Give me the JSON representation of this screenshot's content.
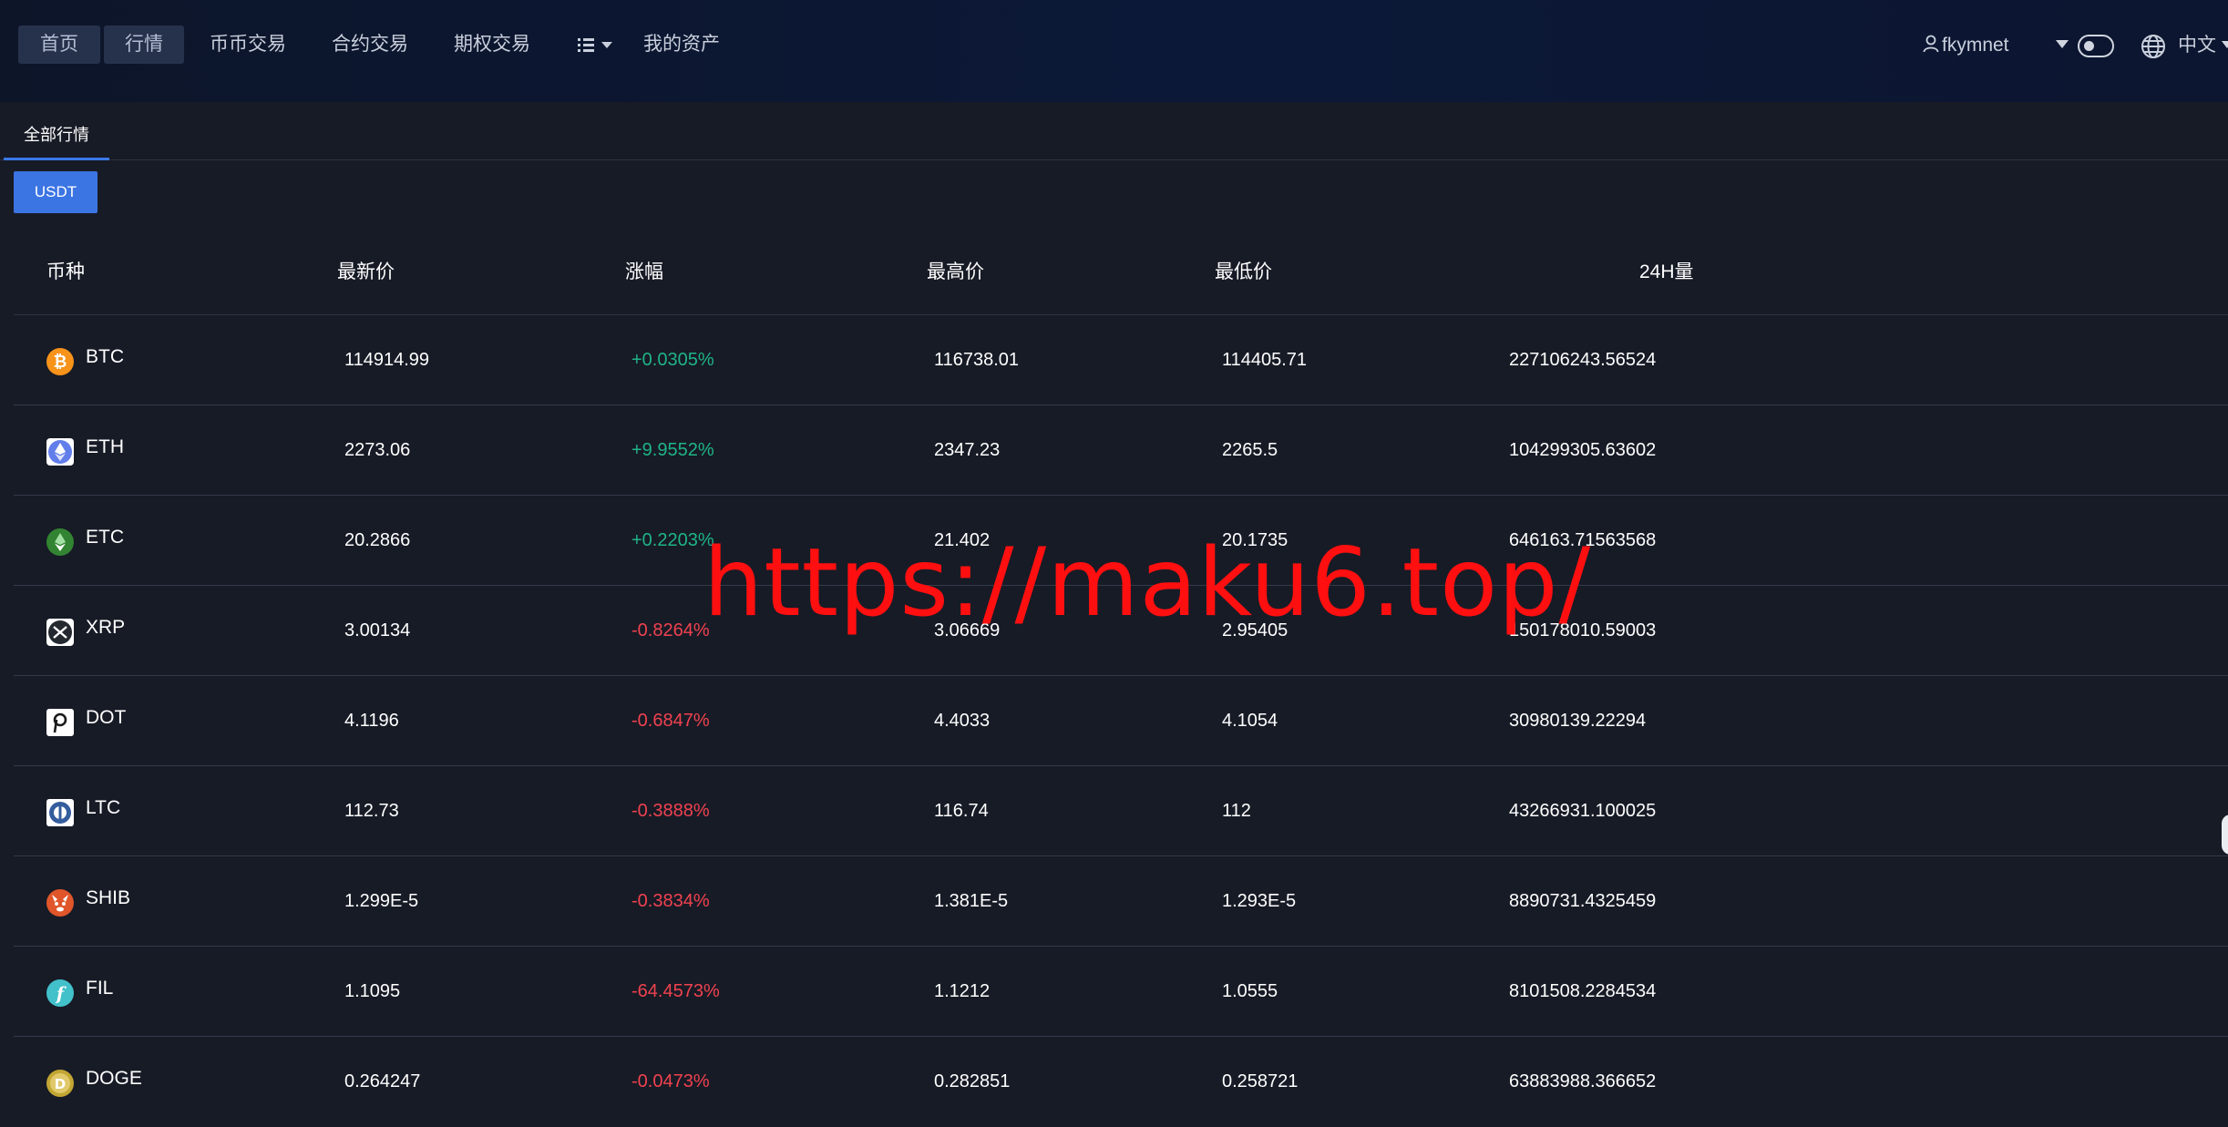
{
  "nav": {
    "items": [
      {
        "label": "首页",
        "boxed": true
      },
      {
        "label": "行情",
        "boxed": true
      },
      {
        "label": "币币交易",
        "boxed": false
      },
      {
        "label": "合约交易",
        "boxed": false
      },
      {
        "label": "期权交易",
        "boxed": false
      }
    ],
    "more_icon": "list-caret-icon",
    "assets_label": "我的资产",
    "username": "fkymnet",
    "language": "中文"
  },
  "tabs": {
    "active": "全部行情"
  },
  "quote_button": "USDT",
  "table": {
    "headers": {
      "coin": "币种",
      "price": "最新价",
      "change": "涨幅",
      "high": "最高价",
      "low": "最低价",
      "volume": "24H量"
    },
    "rows": [
      {
        "symbol": "BTC",
        "icon": "btc-icon",
        "icon_color": "#f7931a",
        "price": "114914.99",
        "change": "+0.0305%",
        "trend": "up",
        "high": "116738.01",
        "low": "114405.71",
        "volume": "227106243.56524"
      },
      {
        "symbol": "ETH",
        "icon": "eth-icon",
        "icon_color": "#627eea",
        "price": "2273.06",
        "change": "+9.9552%",
        "trend": "up",
        "high": "2347.23",
        "low": "2265.5",
        "volume": "104299305.63602"
      },
      {
        "symbol": "ETC",
        "icon": "etc-icon",
        "icon_color": "#328332",
        "price": "20.2866",
        "change": "+0.2203%",
        "trend": "up",
        "high": "21.402",
        "low": "20.1735",
        "volume": "646163.71563568"
      },
      {
        "symbol": "XRP",
        "icon": "xrp-icon",
        "icon_color": "#23292f",
        "price": "3.00134",
        "change": "-0.8264%",
        "trend": "down",
        "high": "3.06669",
        "low": "2.95405",
        "volume": "150178010.59003"
      },
      {
        "symbol": "DOT",
        "icon": "dot-icon",
        "icon_color": "#1a1a1a",
        "price": "4.1196",
        "change": "-0.6847%",
        "trend": "down",
        "high": "4.4033",
        "low": "4.1054",
        "volume": "30980139.22294"
      },
      {
        "symbol": "LTC",
        "icon": "ltc-icon",
        "icon_color": "#345d9d",
        "price": "112.73",
        "change": "-0.3888%",
        "trend": "down",
        "high": "116.74",
        "low": "112",
        "volume": "43266931.100025"
      },
      {
        "symbol": "SHIB",
        "icon": "shib-icon",
        "icon_color": "#e0562a",
        "price": "1.299E-5",
        "change": "-0.3834%",
        "trend": "down",
        "high": "1.381E-5",
        "low": "1.293E-5",
        "volume": "8890731.4325459"
      },
      {
        "symbol": "FIL",
        "icon": "fil-icon",
        "icon_color": "#42c1ca",
        "price": "1.1095",
        "change": "-64.4573%",
        "trend": "down",
        "high": "1.1212",
        "low": "1.0555",
        "volume": "8101508.2284534"
      },
      {
        "symbol": "DOGE",
        "icon": "doge-icon",
        "icon_color": "#c2a633",
        "price": "0.264247",
        "change": "-0.0473%",
        "trend": "down",
        "high": "0.282851",
        "low": "0.258721",
        "volume": "63883988.366652"
      }
    ]
  },
  "watermark": "https://maku6.top/"
}
